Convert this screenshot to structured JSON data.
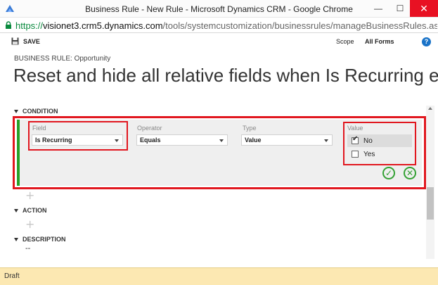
{
  "window": {
    "title": "Business Rule - New Rule - Microsoft Dynamics CRM - Google Chrome"
  },
  "address": {
    "scheme": "https://",
    "host": "visionet3.crm5.dynamics.com",
    "path": "/tools/systemcustomization/businessrules/manageBusinessRules.aspx?BRlau"
  },
  "toolbar": {
    "save_label": "SAVE",
    "scope_label": "Scope",
    "scope_value": "All Forms",
    "help_label": "?"
  },
  "rule": {
    "entity_label": "BUSINESS RULE: Opportunity",
    "title": "Reset and hide all relative fields when Is Recurring equ"
  },
  "condition": {
    "header": "CONDITION",
    "field_label": "Field",
    "field_value": "Is Recurring",
    "operator_label": "Operator",
    "operator_value": "Equals",
    "type_label": "Type",
    "type_value": "Value",
    "value_label": "Value",
    "options": [
      {
        "label": "No",
        "checked": true
      },
      {
        "label": "Yes",
        "checked": false
      }
    ]
  },
  "action": {
    "header": "ACTION"
  },
  "description": {
    "header": "DESCRIPTION",
    "value": "--"
  },
  "status": {
    "text": "Draft"
  },
  "colors": {
    "highlight_red": "#e1171f",
    "accent_green": "#33a133",
    "status_bg": "#fce8b2"
  }
}
